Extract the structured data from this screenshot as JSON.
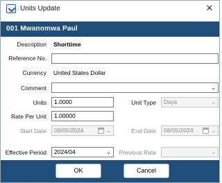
{
  "window": {
    "title": "Units Update",
    "close_glyph": "✕"
  },
  "header": {
    "code": "001",
    "name": "Mwanomwa Paul"
  },
  "form": {
    "description": {
      "label": "Description",
      "value": "Shorttime"
    },
    "reference_no": {
      "label": "Reference No.",
      "value": ""
    },
    "currency": {
      "label": "Currency",
      "value": "United States Dollar"
    },
    "comment": {
      "label": "Comment",
      "value": ""
    },
    "units": {
      "label": "Units",
      "value": "1.0000"
    },
    "unit_type": {
      "label": "Unit Type",
      "value": "Days"
    },
    "rate_per_unit": {
      "label": "Rate Per Unit",
      "value": "1.00000"
    },
    "start_date": {
      "label": "Start Date",
      "value": "08/05/2024"
    },
    "end_date": {
      "label": "End Date",
      "value": "08/05/2024"
    },
    "effective_period": {
      "label": "Effective Period",
      "value": "2024/04"
    },
    "previous_rate": {
      "label": "Previous Rate",
      "value": ""
    }
  },
  "buttons": {
    "ok": "OK",
    "cancel": "Cancel"
  },
  "colors": {
    "accent": "#1f4e7a",
    "disabled_text": "#8c8c8c"
  },
  "icons": [
    "units-update-app-icon",
    "close-icon",
    "chevron-down-icon",
    "calendar-icon"
  ]
}
